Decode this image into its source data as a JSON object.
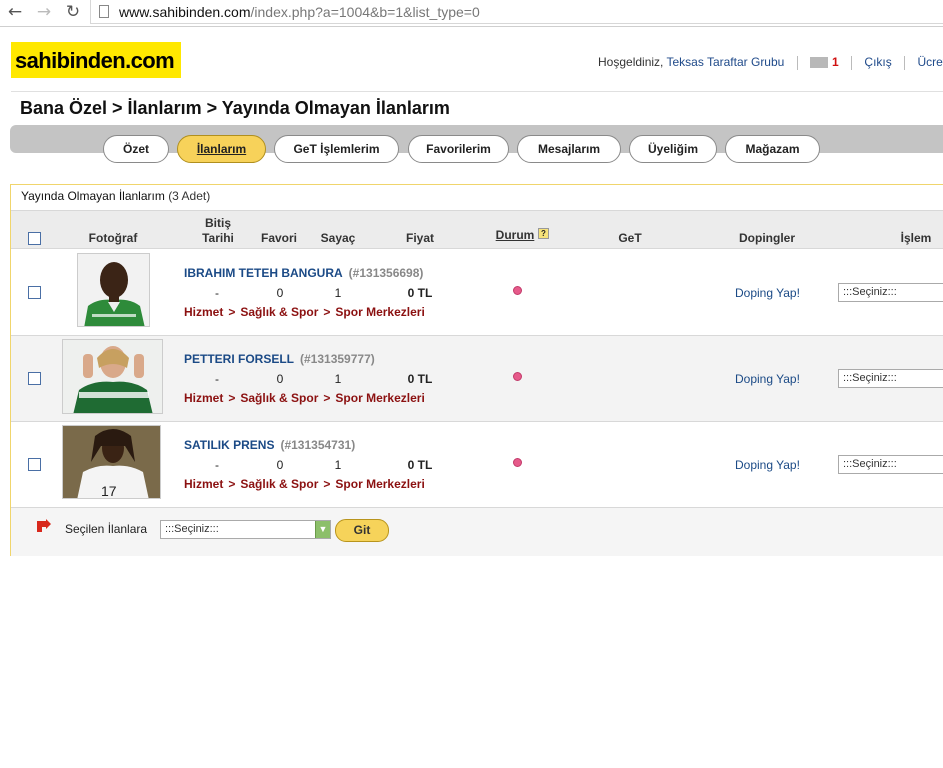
{
  "browser": {
    "url_domain": "www.sahibinden.com",
    "url_path": "/index.php?a=1004&b=1&list_type=0"
  },
  "header": {
    "logo_text": "sahibinden.com",
    "welcome": "Hoşgeldiniz,",
    "username": "Teksas Taraftar Grubu",
    "message_count": "1",
    "logout": "Çıkış",
    "cut_link": "Ücretsi"
  },
  "breadcrumb": "Bana Özel > İlanlarım > Yayında Olmayan İlanlarım",
  "tabs": [
    {
      "label": "Özet"
    },
    {
      "label": "İlanlarım"
    },
    {
      "label": "GeT İşlemlerim"
    },
    {
      "label": "Favorilerim"
    },
    {
      "label": "Mesajlarım"
    },
    {
      "label": "Üyeliğim"
    },
    {
      "label": "Mağazam"
    }
  ],
  "panel": {
    "title": "Yayında Olmayan İlanlarım",
    "count": "(3 Adet)"
  },
  "columns": {
    "photo": "Fotoğraf",
    "end_date_1": "Bitiş",
    "end_date_2": "Tarihi",
    "favorites": "Favori",
    "counter": "Sayaç",
    "price": "Fiyat",
    "status": "Durum",
    "get": "GeT",
    "dopings": "Dopingler",
    "action": "İşlem"
  },
  "listings": [
    {
      "name": "IBRAHIM TETEH BANGURA",
      "id": "(#131356698)",
      "end_date": "-",
      "favorites": "0",
      "counter": "1",
      "price": "0 TL",
      "cat1": "Hizmet",
      "cat2": "Sağlık & Spor",
      "cat3": "Spor Merkezleri",
      "doping": "Doping Yap!",
      "select": ":::Seçiniz:::"
    },
    {
      "name": "PETTERI FORSELL",
      "id": "(#131359777)",
      "end_date": "-",
      "favorites": "0",
      "counter": "1",
      "price": "0 TL",
      "cat1": "Hizmet",
      "cat2": "Sağlık & Spor",
      "cat3": "Spor Merkezleri",
      "doping": "Doping Yap!",
      "select": ":::Seçiniz:::"
    },
    {
      "name": "SATILIK PRENS",
      "id": "(#131354731)",
      "end_date": "-",
      "favorites": "0",
      "counter": "1",
      "price": "0 TL",
      "cat1": "Hizmet",
      "cat2": "Sağlık & Spor",
      "cat3": "Spor Merkezleri",
      "doping": "Doping Yap!",
      "select": ":::Seçiniz:::"
    }
  ],
  "bulk": {
    "label": "Seçilen İlanlara",
    "select": ":::Seçiniz:::",
    "go": "Git"
  },
  "colors": {
    "brand_yellow": "#ffe800",
    "link_blue": "#1b4a86",
    "category_red": "#8b1010"
  }
}
